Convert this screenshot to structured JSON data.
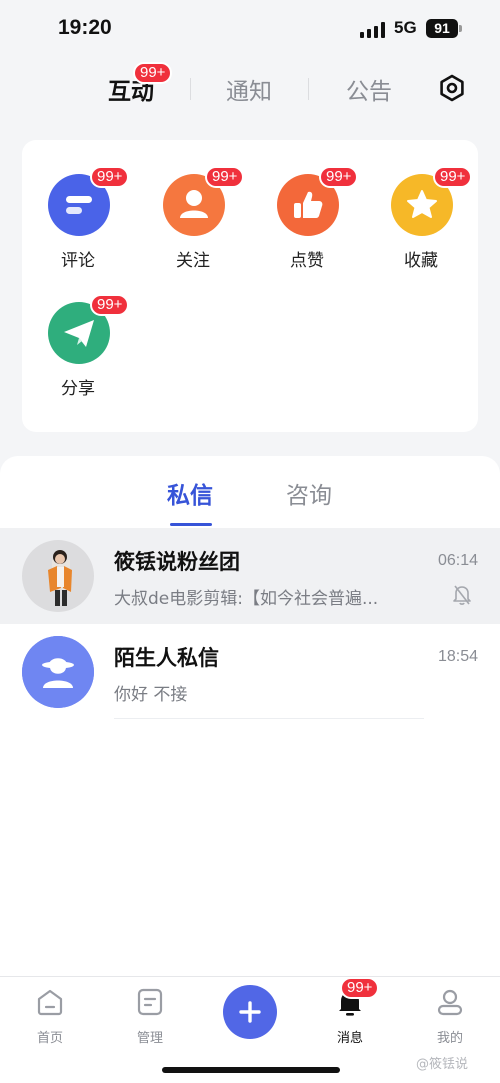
{
  "status_bar": {
    "time": "19:20",
    "network": "5G",
    "battery": "91"
  },
  "top_tabs": {
    "interact": "互动",
    "notify": "通知",
    "announce": "公告",
    "interact_badge": "99+"
  },
  "grid": [
    {
      "label": "评论",
      "badge": "99+",
      "icon": "comment-icon",
      "color": "#4a63e8"
    },
    {
      "label": "关注",
      "badge": "99+",
      "icon": "follow-icon",
      "color": "#f5773f"
    },
    {
      "label": "点赞",
      "badge": "99+",
      "icon": "like-icon",
      "color": "#f3683a"
    },
    {
      "label": "收藏",
      "badge": "99+",
      "icon": "favorite-icon",
      "color": "#f6b828"
    },
    {
      "label": "分享",
      "badge": "99+",
      "icon": "share-icon",
      "color": "#2fae7d"
    }
  ],
  "message_tabs": {
    "private": "私信",
    "consult": "咨询"
  },
  "conversations": [
    {
      "name": "筱铥说粉丝团",
      "preview": "大叔de电影剪辑:【如今社会普遍...",
      "time": "06:14",
      "muted": true
    },
    {
      "name": "陌生人私信",
      "preview": "你好 不接",
      "time": "18:54",
      "muted": false
    }
  ],
  "bottom_nav": {
    "home": "首页",
    "manage": "管理",
    "messages": "消息",
    "mine": "我的",
    "messages_badge": "99+"
  },
  "watermark": "@筱铥说",
  "colors": {
    "accent": "#3754d8",
    "badge": "#f0303c"
  }
}
